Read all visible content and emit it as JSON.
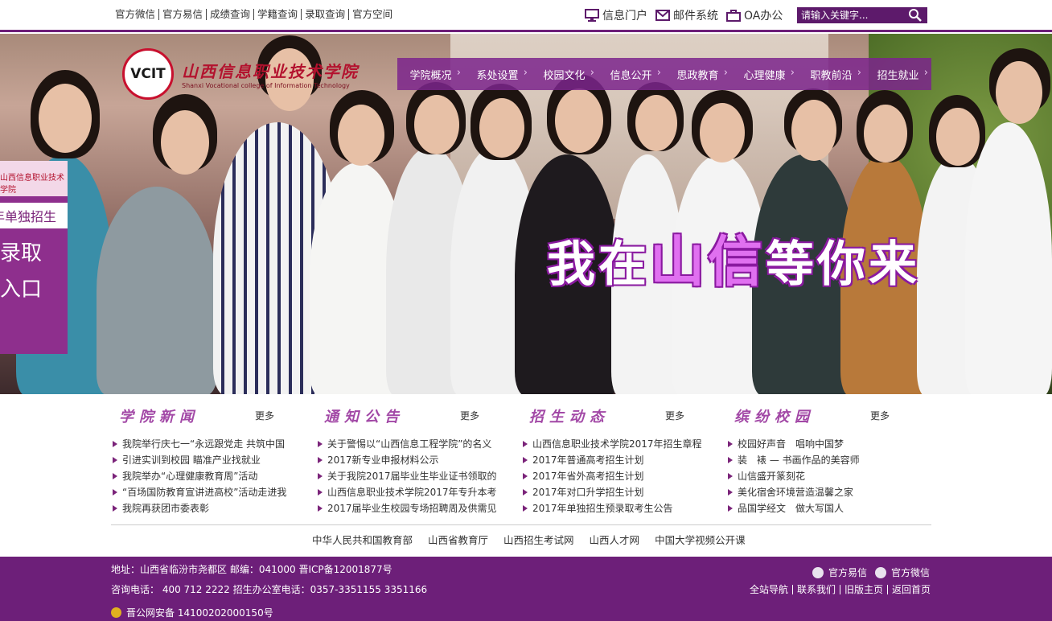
{
  "top_links": [
    "官方微信",
    "官方易信",
    "成绩查询",
    "学籍查询",
    "录取查询",
    "官方空间"
  ],
  "systems": [
    "信息门户",
    "邮件系统",
    "OA办公"
  ],
  "search": {
    "placeholder": "请输入关键字..."
  },
  "logo": {
    "badge": "VCIT",
    "cn": "山西信息职业技术学院",
    "en": "Shanxi Vocational college of Information Technology"
  },
  "main_nav": [
    "学院概况",
    "系处设置",
    "校园文化",
    "信息公开",
    "思政教育",
    "心理健康",
    "职教前沿",
    "招生就业"
  ],
  "slogan": {
    "part1": "我在",
    "part2": "山信",
    "part3": "等你来"
  },
  "side_promo": {
    "header": "山西信息职业技术学院",
    "line1": "年单独招生",
    "line2": "式录取",
    "line3": "询入口"
  },
  "sections": [
    {
      "title": "学院新闻",
      "more": "更多",
      "items": [
        "我院举行庆七一“永远跟党走 共筑中国",
        "引进实训到校园 瞄准产业找就业",
        "我院举办“心理健康教育周”活动",
        "“百场国防教育宣讲进高校”活动走进我",
        "我院再获团市委表彰"
      ]
    },
    {
      "title": "通知公告",
      "more": "更多",
      "items": [
        "关于警惕以“山西信息工程学院”的名义",
        "2017新专业申报材料公示",
        "关于我院2017届毕业生毕业证书领取的",
        "山西信息职业技术学院2017年专升本考",
        "2017届毕业生校园专场招聘周及供需见"
      ]
    },
    {
      "title": "招生动态",
      "more": "更多",
      "items": [
        "山西信息职业技术学院2017年招生章程",
        "2017年普通高考招生计划",
        "2017年省外高考招生计划",
        "2017年对口升学招生计划",
        "2017年单独招生预录取考生公告"
      ]
    },
    {
      "title": "缤纷校园",
      "more": "更多",
      "items": [
        "校园好声音　唱响中国梦",
        "装　裱 — 书画作品的美容师",
        "山信盛开篆刻花",
        "美化宿舍环境营造温馨之家",
        "品国学经文　做大写国人"
      ]
    }
  ],
  "friend_links": [
    "中华人民共和国教育部",
    "山西省教育厅",
    "山西招生考试网",
    "山西人才网",
    "中国大学视频公开课"
  ],
  "footer": {
    "address": "地址：山西省临汾市尧都区 邮编：041000 晋ICP备12001877号",
    "phone": "咨询电话： 400 712 2222 招生办公室电话：0357-3351155 3351166",
    "police": "晋公网安备 14100202000150号",
    "social": [
      "官方易信",
      "官方微信"
    ],
    "links": [
      "全站导航",
      "联系我们",
      "旧版主页",
      "返回首页"
    ]
  },
  "colors": {
    "brand": "#6d1f79",
    "nav": "#7b248c",
    "accent": "#a248a6"
  }
}
